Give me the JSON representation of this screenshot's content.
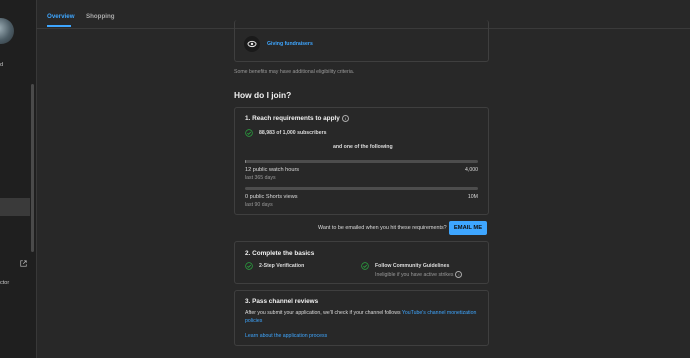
{
  "tabs": [
    {
      "label": "Overview",
      "active": true
    },
    {
      "label": "Shopping",
      "active": false
    }
  ],
  "sidebar": {
    "fragments": [
      "d",
      "ctor"
    ]
  },
  "benefits": {
    "item_label": "Giving fundraisers",
    "note": "Some benefits may have additional eligibility criteria."
  },
  "join": {
    "heading": "How do I join?"
  },
  "step1": {
    "title": "1. Reach requirements to apply",
    "subscribers": "88,983 of 1,000 subscribers",
    "separator": "and one of the following",
    "watch_hours": {
      "label": "12 public watch hours",
      "sub": "last 365 days",
      "goal": "4,000",
      "progress": 0.003
    },
    "shorts_views": {
      "label": "0 public Shorts views",
      "sub": "last 90 days",
      "goal": "10M",
      "progress": 0
    }
  },
  "email": {
    "prompt": "Want to be emailed when you hit these requirements?",
    "button": "EMAIL ME"
  },
  "step2": {
    "title": "2. Complete the basics",
    "verification": "2-Step Verification",
    "community": "Follow Community Guidelines",
    "community_sub": "Ineligible if you have active strikes"
  },
  "step3": {
    "title": "3. Pass channel reviews",
    "body": "After you submit your application, we'll check if your channel follows",
    "policy_link": "YouTube's channel monetization policies",
    "learn_link": "Learn about the application process"
  },
  "colors": {
    "accent": "#3ea6ff",
    "check": "#2ba640",
    "bg": "#282828"
  }
}
